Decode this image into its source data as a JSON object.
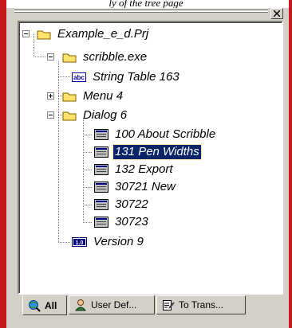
{
  "header": {
    "partial_caption": "ly of the tree page"
  },
  "tree": {
    "nodes": [
      {
        "label": "Example_e_d.Prj",
        "icon": "folder-icon"
      },
      {
        "label": "scribble.exe",
        "icon": "folder-icon"
      },
      {
        "label": "String Table 163",
        "icon": "string-table-icon",
        "icon_text": "abc"
      },
      {
        "label": "Menu 4",
        "icon": "folder-icon"
      },
      {
        "label": "Dialog 6",
        "icon": "folder-icon"
      },
      {
        "label": "100 About Scribble",
        "icon": "dialog-resource-icon"
      },
      {
        "label": "131 Pen Widths",
        "icon": "dialog-resource-icon",
        "selected": true
      },
      {
        "label": "132 Export",
        "icon": "dialog-resource-icon"
      },
      {
        "label": "30721 New",
        "icon": "dialog-resource-icon"
      },
      {
        "label": "30722",
        "icon": "dialog-resource-icon"
      },
      {
        "label": "30723",
        "icon": "dialog-resource-icon"
      },
      {
        "label": "Version 9",
        "icon": "version-icon",
        "icon_text": "1.0"
      }
    ]
  },
  "tabs": [
    {
      "label": "All",
      "icon": "globe-magnifier-icon",
      "active": true
    },
    {
      "label": "User Def...",
      "icon": "user-icon"
    },
    {
      "label": "To Trans...",
      "icon": "edit-document-icon"
    }
  ],
  "colors": {
    "window_face": "#d4d0c8",
    "selection": "#0a246a",
    "folder": "#ffe36b",
    "accent_red": "#c8171d"
  }
}
